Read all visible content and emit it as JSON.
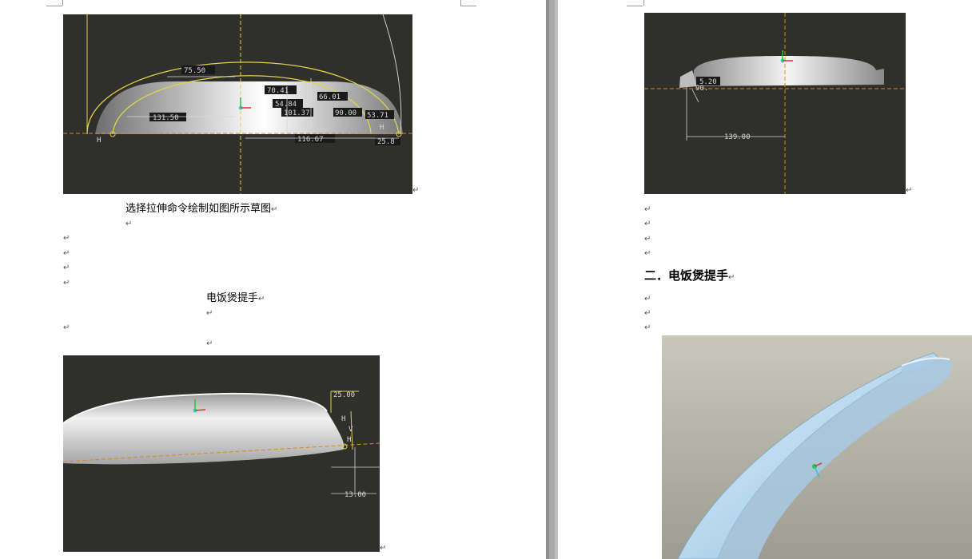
{
  "document": {
    "left_page": {
      "caption_sketch": "选择拉伸命令绘制如图所示草图",
      "subtitle_handle": "电饭煲提手"
    },
    "right_page": {
      "heading_section": "二．电饭煲提手"
    },
    "paragraph_mark": "↵"
  },
  "figures": {
    "sketch_top": {
      "dimensions": [
        "75.50",
        "70.41",
        "66.01",
        "54.84",
        "131.50",
        "101.37",
        "90.00",
        "53.71",
        "116.67",
        "25.8"
      ],
      "labels": [
        "H",
        "H"
      ]
    },
    "side_profile": {
      "dimensions": [
        "25.00",
        "13.00"
      ],
      "labels": [
        "H",
        "V",
        "H"
      ]
    },
    "right_sketch": {
      "dimensions": [
        "5.20",
        "90.",
        "139.00"
      ]
    },
    "handle_model": {
      "colors": {
        "background_top": "#c9c8bd",
        "background_bottom": "#9d9c90",
        "handle": "#b7d7ee"
      }
    }
  },
  "colors": {
    "cad_background": "#2f2f2b",
    "sketch_yellow": "#e0d24a",
    "dim_box": "#1a1a1a",
    "page_gap": "#a9a9a9"
  }
}
